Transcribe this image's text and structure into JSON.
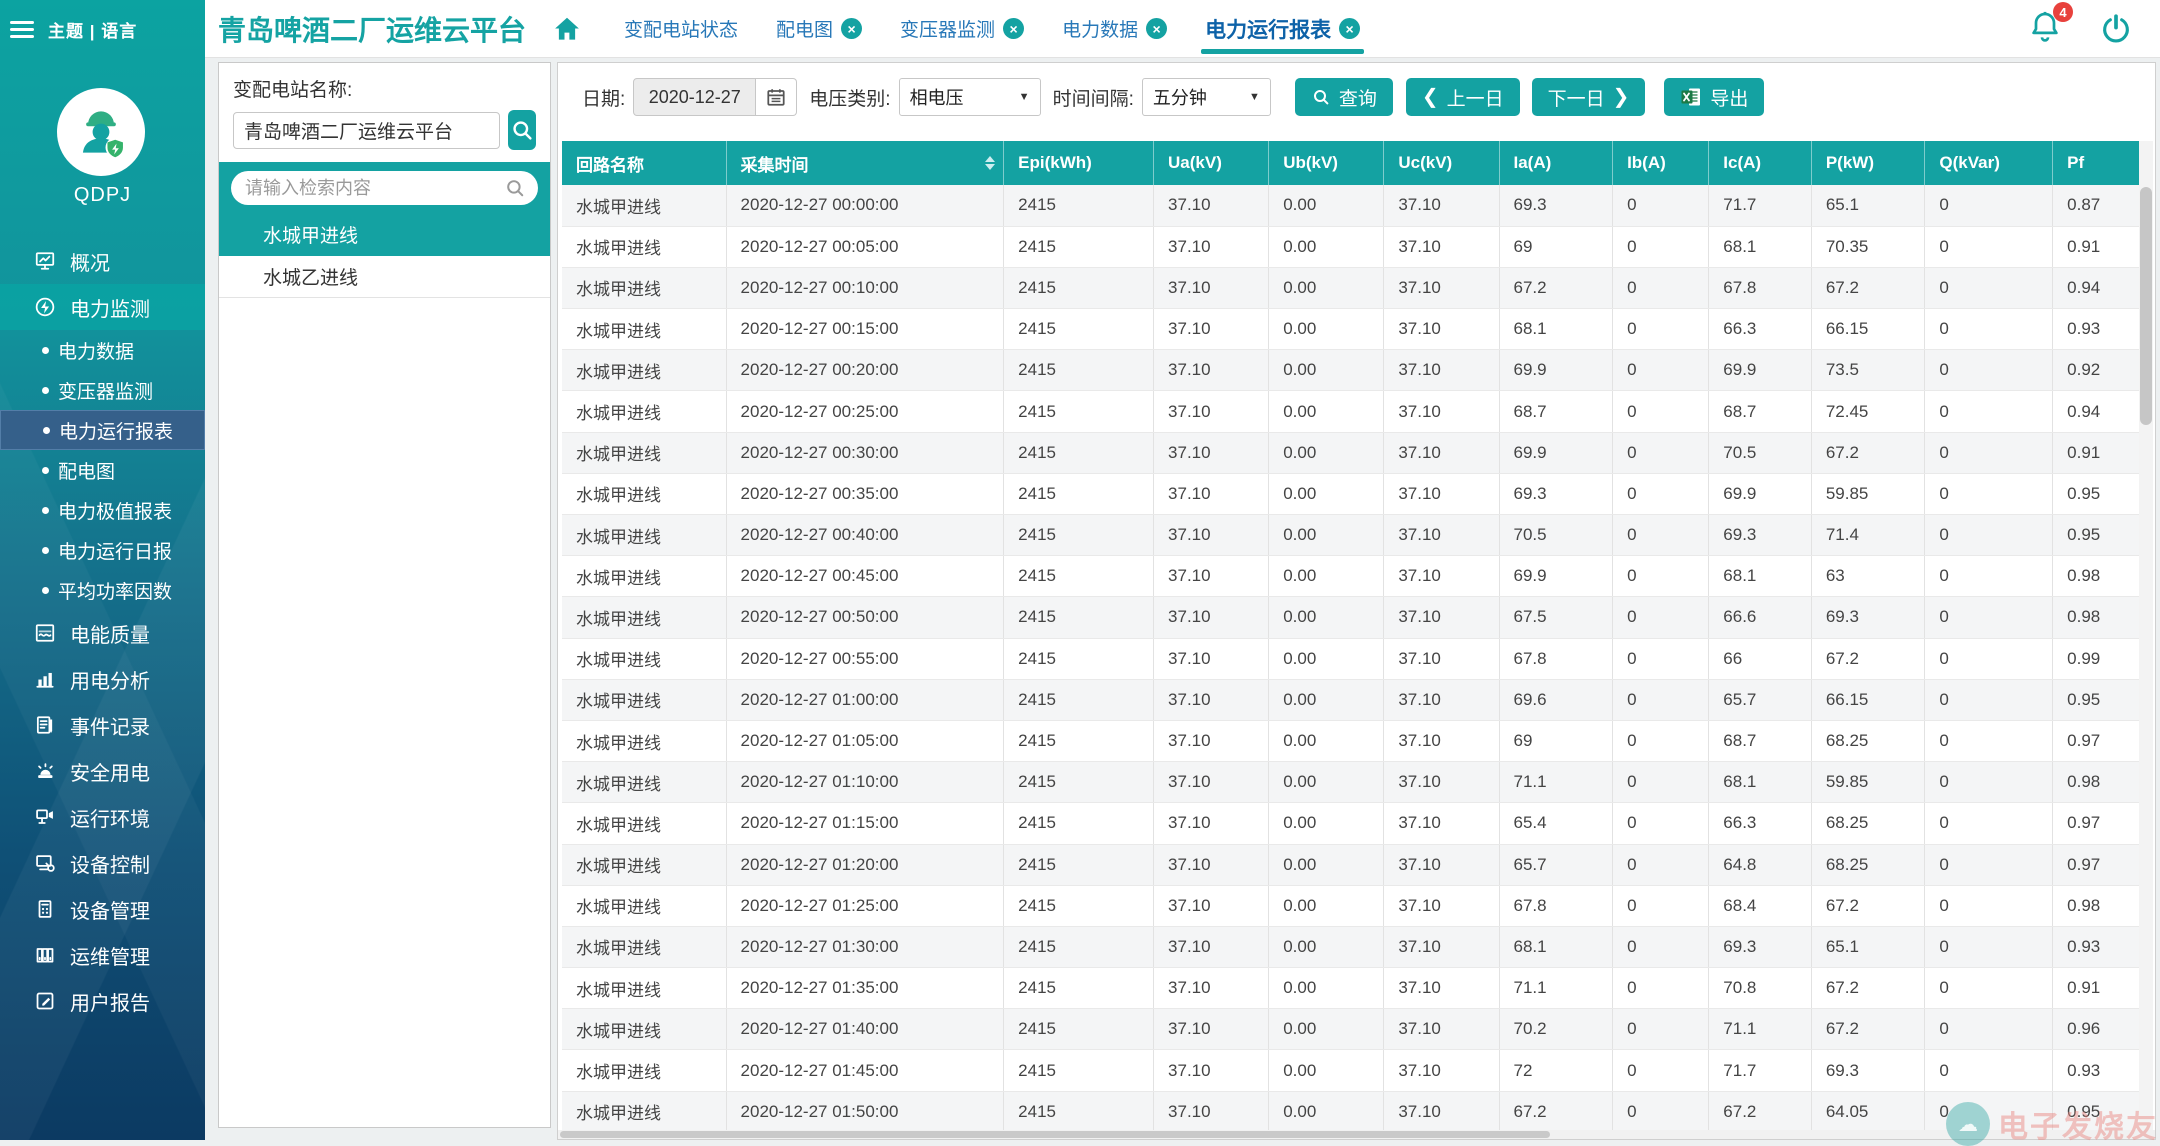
{
  "branding": {
    "topbar_left": "主题 | 语言",
    "org": "QDPJ",
    "title": "青岛啤酒二厂运维云平台"
  },
  "notifications": {
    "count": "4"
  },
  "icons": {
    "menu_toggle": "hamburger-icon",
    "home": "home-icon",
    "bell": "bell-icon",
    "power": "power-icon",
    "search": "search-icon",
    "calendar": "calendar-icon",
    "excel": "excel-icon",
    "sort": "sort-arrows-icon"
  },
  "sidebar": {
    "menu": [
      {
        "label": "概况",
        "icon": "overview-icon",
        "active": false
      },
      {
        "label": "电力监测",
        "icon": "power-monitoring-icon",
        "active": true,
        "children": [
          {
            "label": "电力数据",
            "active": false
          },
          {
            "label": "变压器监测",
            "active": false
          },
          {
            "label": "电力运行报表",
            "active": true
          },
          {
            "label": "配电图",
            "active": false
          },
          {
            "label": "电力极值报表",
            "active": false
          },
          {
            "label": "电力运行日报",
            "active": false
          },
          {
            "label": "平均功率因数",
            "active": false
          }
        ]
      },
      {
        "label": "电能质量",
        "icon": "power-quality-icon",
        "active": false
      },
      {
        "label": "用电分析",
        "icon": "usage-analysis-icon",
        "active": false
      },
      {
        "label": "事件记录",
        "icon": "event-log-icon",
        "active": false
      },
      {
        "label": "安全用电",
        "icon": "safety-power-icon",
        "active": false
      },
      {
        "label": "运行环境",
        "icon": "environment-icon",
        "active": false
      },
      {
        "label": "设备控制",
        "icon": "device-control-icon",
        "active": false
      },
      {
        "label": "设备管理",
        "icon": "device-management-icon",
        "active": false
      },
      {
        "label": "运维管理",
        "icon": "ops-management-icon",
        "active": false
      },
      {
        "label": "用户报告",
        "icon": "user-report-icon",
        "active": false
      }
    ]
  },
  "tabs": [
    {
      "label": "变配电站状态",
      "closable": false,
      "active": false
    },
    {
      "label": "配电图",
      "closable": true,
      "active": false
    },
    {
      "label": "变压器监测",
      "closable": true,
      "active": false
    },
    {
      "label": "电力数据",
      "closable": true,
      "active": false
    },
    {
      "label": "电力运行报表",
      "closable": true,
      "active": true
    }
  ],
  "station_panel": {
    "label": "变配电站名称:",
    "station_value": "青岛啤酒二厂运维云平台",
    "search_placeholder": "请输入检索内容",
    "circuits": [
      {
        "name": "水城甲进线",
        "selected": true
      },
      {
        "name": "水城乙进线",
        "selected": false
      }
    ]
  },
  "toolbar": {
    "date_label": "日期:",
    "date_value": "2020-12-27",
    "voltage_label": "电压类别:",
    "voltage_value": "相电压",
    "interval_label": "时间间隔:",
    "interval_value": "五分钟",
    "query_label": "查询",
    "prev_label": "上一日",
    "next_label": "下一日",
    "export_label": "导出"
  },
  "table": {
    "columns": [
      "回路名称",
      "采集时间",
      "Epi(kWh)",
      "Ua(kV)",
      "Ub(kV)",
      "Uc(kV)",
      "Ia(A)",
      "Ib(A)",
      "Ic(A)",
      "P(kW)",
      "Q(kVar)",
      "Pf"
    ],
    "sortable_column": "采集时间",
    "rows": [
      [
        "水城甲进线",
        "2020-12-27 00:00:00",
        "2415",
        "37.10",
        "0.00",
        "37.10",
        "69.3",
        "0",
        "71.7",
        "65.1",
        "0",
        "0.87"
      ],
      [
        "水城甲进线",
        "2020-12-27 00:05:00",
        "2415",
        "37.10",
        "0.00",
        "37.10",
        "69",
        "0",
        "68.1",
        "70.35",
        "0",
        "0.91"
      ],
      [
        "水城甲进线",
        "2020-12-27 00:10:00",
        "2415",
        "37.10",
        "0.00",
        "37.10",
        "67.2",
        "0",
        "67.8",
        "67.2",
        "0",
        "0.94"
      ],
      [
        "水城甲进线",
        "2020-12-27 00:15:00",
        "2415",
        "37.10",
        "0.00",
        "37.10",
        "68.1",
        "0",
        "66.3",
        "66.15",
        "0",
        "0.93"
      ],
      [
        "水城甲进线",
        "2020-12-27 00:20:00",
        "2415",
        "37.10",
        "0.00",
        "37.10",
        "69.9",
        "0",
        "69.9",
        "73.5",
        "0",
        "0.92"
      ],
      [
        "水城甲进线",
        "2020-12-27 00:25:00",
        "2415",
        "37.10",
        "0.00",
        "37.10",
        "68.7",
        "0",
        "68.7",
        "72.45",
        "0",
        "0.94"
      ],
      [
        "水城甲进线",
        "2020-12-27 00:30:00",
        "2415",
        "37.10",
        "0.00",
        "37.10",
        "69.9",
        "0",
        "70.5",
        "67.2",
        "0",
        "0.91"
      ],
      [
        "水城甲进线",
        "2020-12-27 00:35:00",
        "2415",
        "37.10",
        "0.00",
        "37.10",
        "69.3",
        "0",
        "69.9",
        "59.85",
        "0",
        "0.95"
      ],
      [
        "水城甲进线",
        "2020-12-27 00:40:00",
        "2415",
        "37.10",
        "0.00",
        "37.10",
        "70.5",
        "0",
        "69.3",
        "71.4",
        "0",
        "0.95"
      ],
      [
        "水城甲进线",
        "2020-12-27 00:45:00",
        "2415",
        "37.10",
        "0.00",
        "37.10",
        "69.9",
        "0",
        "68.1",
        "63",
        "0",
        "0.98"
      ],
      [
        "水城甲进线",
        "2020-12-27 00:50:00",
        "2415",
        "37.10",
        "0.00",
        "37.10",
        "67.5",
        "0",
        "66.6",
        "69.3",
        "0",
        "0.98"
      ],
      [
        "水城甲进线",
        "2020-12-27 00:55:00",
        "2415",
        "37.10",
        "0.00",
        "37.10",
        "67.8",
        "0",
        "66",
        "67.2",
        "0",
        "0.99"
      ],
      [
        "水城甲进线",
        "2020-12-27 01:00:00",
        "2415",
        "37.10",
        "0.00",
        "37.10",
        "69.6",
        "0",
        "65.7",
        "66.15",
        "0",
        "0.95"
      ],
      [
        "水城甲进线",
        "2020-12-27 01:05:00",
        "2415",
        "37.10",
        "0.00",
        "37.10",
        "69",
        "0",
        "68.7",
        "68.25",
        "0",
        "0.97"
      ],
      [
        "水城甲进线",
        "2020-12-27 01:10:00",
        "2415",
        "37.10",
        "0.00",
        "37.10",
        "71.1",
        "0",
        "68.1",
        "59.85",
        "0",
        "0.98"
      ],
      [
        "水城甲进线",
        "2020-12-27 01:15:00",
        "2415",
        "37.10",
        "0.00",
        "37.10",
        "65.4",
        "0",
        "66.3",
        "68.25",
        "0",
        "0.97"
      ],
      [
        "水城甲进线",
        "2020-12-27 01:20:00",
        "2415",
        "37.10",
        "0.00",
        "37.10",
        "65.7",
        "0",
        "64.8",
        "68.25",
        "0",
        "0.97"
      ],
      [
        "水城甲进线",
        "2020-12-27 01:25:00",
        "2415",
        "37.10",
        "0.00",
        "37.10",
        "67.8",
        "0",
        "68.4",
        "67.2",
        "0",
        "0.98"
      ],
      [
        "水城甲进线",
        "2020-12-27 01:30:00",
        "2415",
        "37.10",
        "0.00",
        "37.10",
        "68.1",
        "0",
        "69.3",
        "65.1",
        "0",
        "0.93"
      ],
      [
        "水城甲进线",
        "2020-12-27 01:35:00",
        "2415",
        "37.10",
        "0.00",
        "37.10",
        "71.1",
        "0",
        "70.8",
        "67.2",
        "0",
        "0.91"
      ],
      [
        "水城甲进线",
        "2020-12-27 01:40:00",
        "2415",
        "37.10",
        "0.00",
        "37.10",
        "70.2",
        "0",
        "71.1",
        "67.2",
        "0",
        "0.96"
      ],
      [
        "水城甲进线",
        "2020-12-27 01:45:00",
        "2415",
        "37.10",
        "0.00",
        "37.10",
        "72",
        "0",
        "71.7",
        "69.3",
        "0",
        "0.93"
      ],
      [
        "水城甲进线",
        "2020-12-27 01:50:00",
        "2415",
        "37.10",
        "0.00",
        "37.10",
        "67.2",
        "0",
        "67.2",
        "64.05",
        "0",
        "0.95"
      ]
    ]
  },
  "watermark": {
    "text": "电子发烧友"
  },
  "colors": {
    "teal": "#14a2a2",
    "tab_blue": "#2878b8",
    "active_tab_blue": "#0d62a8",
    "badge_red": "#e8413c",
    "sidebar_top": "#0ca3a1",
    "sidebar_bottom": "#0c3a62",
    "selected_submenu": "#35608a",
    "row_stripe": "#f4f5f6"
  }
}
